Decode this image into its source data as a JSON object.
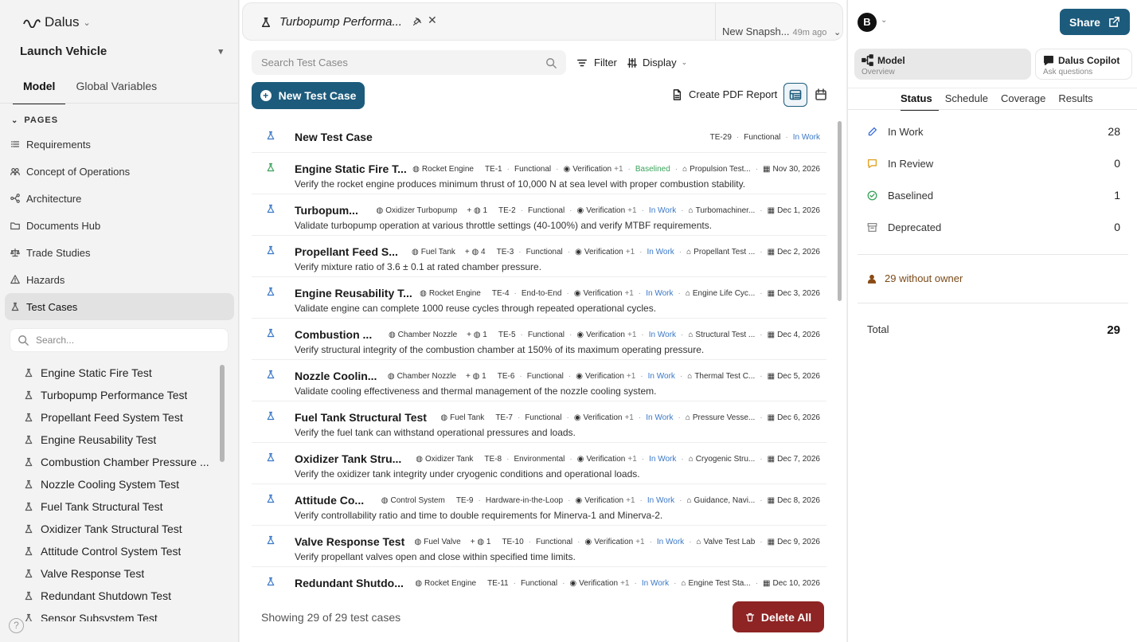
{
  "app": {
    "name": "Dalus",
    "project": "Launch Vehicle"
  },
  "left": {
    "tabs": [
      "Model",
      "Global Variables"
    ],
    "pages_header": "PAGES",
    "pages": [
      {
        "label": "Requirements",
        "icon": "list-icon"
      },
      {
        "label": "Concept of Operations",
        "icon": "users-icon"
      },
      {
        "label": "Architecture",
        "icon": "nodes-icon"
      },
      {
        "label": "Documents Hub",
        "icon": "folder-icon"
      },
      {
        "label": "Trade Studies",
        "icon": "scale-icon"
      },
      {
        "label": "Hazards",
        "icon": "warning-icon"
      },
      {
        "label": "Test Cases",
        "icon": "flask-icon",
        "selected": true
      }
    ],
    "search_placeholder": "Search...",
    "test_items": [
      "Engine Static Fire Test",
      "Turbopump Performance Test",
      "Propellant Feed System Test",
      "Engine Reusability Test",
      "Combustion Chamber Pressure ...",
      "Nozzle Cooling System Test",
      "Fuel Tank Structural Test",
      "Oxidizer Tank Structural Test",
      "Attitude Control System Test",
      "Valve Response Test",
      "Redundant Shutdown Test",
      "Sensor Subsystem Test"
    ],
    "help": "?"
  },
  "center": {
    "tab_title": "Turbopump Performa...",
    "snapshot": "New Snapsh...",
    "snapshot_time": "49m ago",
    "search_placeholder": "Search Test Cases",
    "filter_label": "Filter",
    "display_label": "Display",
    "new_button": "New Test Case",
    "pdf_label": "Create PDF Report",
    "showing": "Showing 29 of 29 test cases",
    "delete_label": "Delete All",
    "rows": [
      {
        "title": "New Test Case",
        "id": "TE-29",
        "type": "Functional",
        "status": "In Work",
        "status_color": "blue"
      },
      {
        "title": "Engine Static Fire T...",
        "component": "Rocket Engine",
        "id": "TE-1",
        "type": "Functional",
        "method": "Verification",
        "method_more": "+1",
        "status": "Baselined",
        "status_color": "green",
        "facility": "Propulsion Test...",
        "date": "Nov 30, 2026",
        "desc": "Verify the rocket engine produces minimum thrust of 10,000 N at sea level with proper combustion stability.",
        "flask": "green"
      },
      {
        "title": "Turbopum...",
        "component": "Oxidizer Turbopump",
        "extra": "1",
        "id": "TE-2",
        "type": "Functional",
        "method": "Verification",
        "method_more": "+1",
        "status": "In Work",
        "status_color": "blue",
        "facility": "Turbomachiner...",
        "date": "Dec 1, 2026",
        "desc": "Validate turbopump operation at various throttle settings (40-100%) and verify MTBF requirements."
      },
      {
        "title": "Propellant Feed S...",
        "component": "Fuel Tank",
        "extra": "4",
        "id": "TE-3",
        "type": "Functional",
        "method": "Verification",
        "method_more": "+1",
        "status": "In Work",
        "status_color": "blue",
        "facility": "Propellant Test ...",
        "date": "Dec 2, 2026",
        "desc": "Verify mixture ratio of 3.6 ± 0.1 at rated chamber pressure."
      },
      {
        "title": "Engine Reusability T...",
        "component": "Rocket Engine",
        "id": "TE-4",
        "type": "End-to-End",
        "method": "Verification",
        "method_more": "+1",
        "status": "In Work",
        "status_color": "blue",
        "facility": "Engine Life Cyc...",
        "date": "Dec 3, 2026",
        "desc": "Validate engine can complete 1000 reuse cycles through repeated operational cycles."
      },
      {
        "title": "Combustion ...",
        "component": "Chamber Nozzle",
        "extra": "1",
        "id": "TE-5",
        "type": "Functional",
        "method": "Verification",
        "method_more": "+1",
        "status": "In Work",
        "status_color": "blue",
        "facility": "Structural Test ...",
        "date": "Dec 4, 2026",
        "desc": "Verify structural integrity of the combustion chamber at 150% of its maximum operating pressure."
      },
      {
        "title": "Nozzle Coolin...",
        "component": "Chamber Nozzle",
        "extra": "1",
        "id": "TE-6",
        "type": "Functional",
        "method": "Verification",
        "method_more": "+1",
        "status": "In Work",
        "status_color": "blue",
        "facility": "Thermal Test C...",
        "date": "Dec 5, 2026",
        "desc": "Validate cooling effectiveness and thermal management of the nozzle cooling system."
      },
      {
        "title": "Fuel Tank Structural Test",
        "component": "Fuel Tank",
        "id": "TE-7",
        "type": "Functional",
        "method": "Verification",
        "method_more": "+1",
        "status": "In Work",
        "status_color": "blue",
        "facility": "Pressure Vesse...",
        "date": "Dec 6, 2026",
        "desc": "Verify the fuel tank can withstand operational pressures and loads."
      },
      {
        "title": "Oxidizer Tank Stru...",
        "component": "Oxidizer Tank",
        "id": "TE-8",
        "type": "Environmental",
        "method": "Verification",
        "method_more": "+1",
        "status": "In Work",
        "status_color": "blue",
        "facility": "Cryogenic Stru...",
        "date": "Dec 7, 2026",
        "desc": "Verify the oxidizer tank integrity under cryogenic conditions and operational loads."
      },
      {
        "title": "Attitude Co...",
        "component": "Control System",
        "id": "TE-9",
        "type": "Hardware-in-the-Loop",
        "method": "Verification",
        "method_more": "+1",
        "status": "In Work",
        "status_color": "blue",
        "facility": "Guidance, Navi...",
        "date": "Dec 8, 2026",
        "desc": "Verify controllability ratio and time to double requirements for Minerva-1 and Minerva-2."
      },
      {
        "title": "Valve Response Test",
        "component": "Fuel Valve",
        "extra": "1",
        "id": "TE-10",
        "type": "Functional",
        "method": "Verification",
        "method_more": "+1",
        "status": "In Work",
        "status_color": "blue",
        "facility": "Valve Test Lab",
        "date": "Dec 9, 2026",
        "desc": "Verify propellant valves open and close within specified time limits."
      },
      {
        "title": "Redundant Shutdo...",
        "component": "Rocket Engine",
        "id": "TE-11",
        "type": "Functional",
        "method": "Verification",
        "method_more": "+1",
        "status": "In Work",
        "status_color": "blue",
        "facility": "Engine Test Sta...",
        "date": "Dec 10, 2026",
        "desc": ""
      }
    ]
  },
  "right": {
    "avatar": "B",
    "share": "Share",
    "model_card": {
      "title": "Model",
      "sub": "Overview"
    },
    "copilot_card": {
      "title": "Dalus Copilot",
      "sub": "Ask questions"
    },
    "tabs": [
      "Status",
      "Schedule",
      "Coverage",
      "Results"
    ],
    "stats": [
      {
        "label": "In Work",
        "value": "28",
        "icon": "pencil-icon",
        "color": "#3a6fd8"
      },
      {
        "label": "In Review",
        "value": "0",
        "icon": "comment-icon",
        "color": "#e0a020"
      },
      {
        "label": "Baselined",
        "value": "1",
        "icon": "check-circle-icon",
        "color": "#3aa35a"
      },
      {
        "label": "Deprecated",
        "value": "0",
        "icon": "archive-icon",
        "color": "#888888"
      }
    ],
    "owner": "29 without owner",
    "total_label": "Total",
    "total_value": "29"
  }
}
